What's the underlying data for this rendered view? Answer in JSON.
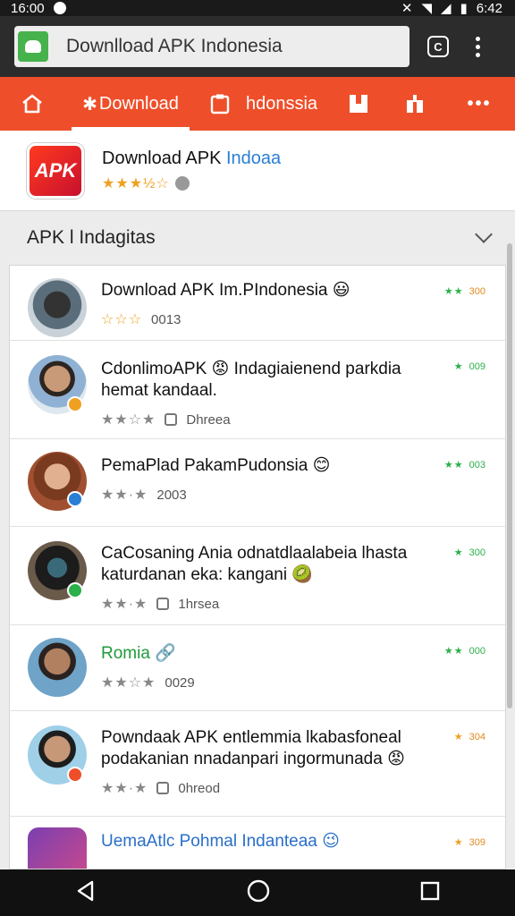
{
  "status_bar": {
    "time_left": "16:00",
    "time_right": "6:42"
  },
  "browser": {
    "url_text": "Downlload APK Indonesia",
    "tab_count": "C"
  },
  "nav": {
    "items": [
      {
        "label": "",
        "icon": "home-icon"
      },
      {
        "label": "Download",
        "icon": "gear-icon",
        "active": true
      },
      {
        "label": "hdonssia",
        "icon": "clipboard-icon"
      },
      {
        "label": "",
        "icon": "bookmark-icon"
      },
      {
        "label": "",
        "icon": "share-icon"
      },
      {
        "label": "•••",
        "icon": "more-icon"
      }
    ]
  },
  "app": {
    "logo_text": "APK",
    "title_main": "Download APK ",
    "title_accent": "Indoaa",
    "stars": "★★★½☆"
  },
  "section": {
    "title": "APK l Indagitas"
  },
  "list": [
    {
      "title": "Download APK Im.PIndonesia 😃",
      "stars": "☆☆☆",
      "meta": "0013",
      "meta_icon": false,
      "rating_stars": "★★",
      "rating_value": "300",
      "rating_color": "green",
      "avatar": "phone",
      "badge": ""
    },
    {
      "title": "CdonlimoAPK 😡 Indagiaienend parkdia hemat kandaal.",
      "stars": "★★☆★",
      "meta": "Dhreea",
      "meta_icon": true,
      "rating_stars": "★",
      "rating_value": "009",
      "rating_color": "green",
      "avatar": "man1",
      "badge": "orange"
    },
    {
      "title": "PemaPlad PakamPudonsia 😊",
      "stars": "★★·★",
      "meta": "2003",
      "meta_icon": false,
      "rating_stars": "★★",
      "rating_value": "003",
      "rating_color": "green",
      "avatar": "woman",
      "badge": "blue"
    },
    {
      "title": "CaCosaning Ania odnatdlaalabeia lhasta katurdanan eka: kangani 🥝",
      "stars": "★★·★",
      "meta": "1hrsea",
      "meta_icon": true,
      "rating_stars": "★",
      "rating_value": "300",
      "rating_color": "green",
      "avatar": "phone2",
      "badge": "green"
    },
    {
      "title": "Romia 🔗",
      "stars": "★★☆★",
      "meta": "0029",
      "meta_icon": false,
      "rating_stars": "★★",
      "rating_value": "000",
      "rating_color": "green",
      "avatar": "man2",
      "badge": "",
      "title_style": "green"
    },
    {
      "title": "Powndaak APK entlemmia lkabasfoneal podakanian nnadanpari ingormunada 😡",
      "stars": "★★·★",
      "meta": "0hreod",
      "meta_icon": true,
      "rating_stars": "★",
      "rating_value": "304",
      "rating_color": "orange",
      "avatar": "man3",
      "badge": "orange"
    },
    {
      "title": "UemaAtlc Pohmal Indanteaa 😉",
      "stars": "",
      "meta": "",
      "meta_icon": false,
      "rating_stars": "★",
      "rating_value": "309",
      "rating_color": "orange",
      "avatar": "app",
      "badge": "",
      "title_style": "blue"
    }
  ],
  "colors": {
    "accent": "#ee4f2a",
    "url_icon": "#46b24b",
    "link_blue": "#2a7fd4",
    "star": "#f0a020",
    "rating_green": "#2bb04a"
  }
}
